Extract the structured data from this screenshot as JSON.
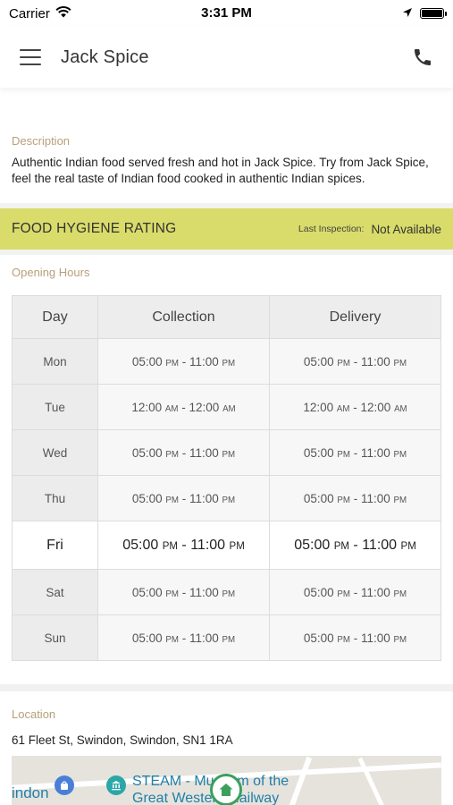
{
  "status_bar": {
    "carrier": "Carrier",
    "time": "3:31 PM"
  },
  "app_bar": {
    "title": "Jack Spice"
  },
  "description": {
    "label": "Description",
    "text": "Authentic Indian food served fresh and hot in Jack Spice. Try from Jack Spice, feel the real taste of Indian food cooked in authentic Indian spices."
  },
  "hygiene": {
    "title": "FOOD HYGIENE RATING",
    "inspection_label": "Last Inspection:",
    "inspection_value": "Not Available",
    "color": "#d9dc6a"
  },
  "opening_hours": {
    "label": "Opening Hours",
    "headers": [
      "Day",
      "Collection",
      "Delivery"
    ],
    "rows": [
      {
        "day": "Mon",
        "collection": {
          "open": "05:00",
          "open_p": "PM",
          "close": "11:00",
          "close_p": "PM"
        },
        "delivery": {
          "open": "05:00",
          "open_p": "PM",
          "close": "11:00",
          "close_p": "PM"
        }
      },
      {
        "day": "Tue",
        "collection": {
          "open": "12:00",
          "open_p": "AM",
          "close": "12:00",
          "close_p": "AM"
        },
        "delivery": {
          "open": "12:00",
          "open_p": "AM",
          "close": "12:00",
          "close_p": "AM"
        }
      },
      {
        "day": "Wed",
        "collection": {
          "open": "05:00",
          "open_p": "PM",
          "close": "11:00",
          "close_p": "PM"
        },
        "delivery": {
          "open": "05:00",
          "open_p": "PM",
          "close": "11:00",
          "close_p": "PM"
        }
      },
      {
        "day": "Thu",
        "collection": {
          "open": "05:00",
          "open_p": "PM",
          "close": "11:00",
          "close_p": "PM"
        },
        "delivery": {
          "open": "05:00",
          "open_p": "PM",
          "close": "11:00",
          "close_p": "PM"
        }
      },
      {
        "day": "Fri",
        "collection": {
          "open": "05:00",
          "open_p": "PM",
          "close": "11:00",
          "close_p": "PM"
        },
        "delivery": {
          "open": "05:00",
          "open_p": "PM",
          "close": "11:00",
          "close_p": "PM"
        }
      },
      {
        "day": "Sat",
        "collection": {
          "open": "05:00",
          "open_p": "PM",
          "close": "11:00",
          "close_p": "PM"
        },
        "delivery": {
          "open": "05:00",
          "open_p": "PM",
          "close": "11:00",
          "close_p": "PM"
        }
      },
      {
        "day": "Sun",
        "collection": {
          "open": "05:00",
          "open_p": "PM",
          "close": "11:00",
          "close_p": "PM"
        },
        "delivery": {
          "open": "05:00",
          "open_p": "PM",
          "close": "11:00",
          "close_p": "PM"
        }
      }
    ],
    "separator": " - "
  },
  "location": {
    "label": "Location",
    "address": "61 Fleet St, Swindon, Swindon, SN1 1RA",
    "map": {
      "label_left": "indon",
      "poi_name": "STEAM - Museum of the",
      "poi_name_line2": "Great Western Railway"
    }
  }
}
